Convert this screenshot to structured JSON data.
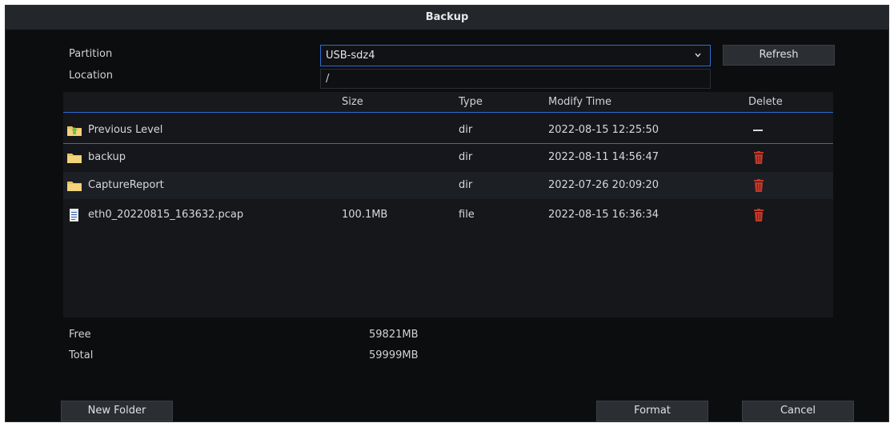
{
  "dialog": {
    "title": "Backup",
    "partition_label": "Partition",
    "location_label": "Location",
    "partition_value": "USB-sdz4",
    "location_value": "/",
    "refresh_label": "Refresh"
  },
  "table": {
    "headers": {
      "size": "Size",
      "type": "Type",
      "modify_time": "Modify Time",
      "delete": "Delete"
    },
    "rows": [
      {
        "name": "Previous Level",
        "size": "",
        "type": "dir",
        "modify_time": "2022-08-15 12:25:50",
        "icon": "folder-up-icon",
        "delete": "dash"
      },
      {
        "name": "backup",
        "size": "",
        "type": "dir",
        "modify_time": "2022-08-11 14:56:47",
        "icon": "folder-icon",
        "delete": "trash"
      },
      {
        "name": "CaptureReport",
        "size": "",
        "type": "dir",
        "modify_time": "2022-07-26 20:09:20",
        "icon": "folder-icon",
        "delete": "trash"
      },
      {
        "name": "eth0_20220815_163632.pcap",
        "size": "100.1MB",
        "type": "file",
        "modify_time": "2022-08-15 16:36:34",
        "icon": "file-icon",
        "delete": "trash"
      }
    ]
  },
  "storage": {
    "free_label": "Free",
    "free_value": "59821MB",
    "total_label": "Total",
    "total_value": "59999MB"
  },
  "buttons": {
    "new_folder": "New Folder",
    "format": "Format",
    "cancel": "Cancel"
  },
  "colors": {
    "accent": "#2f6bd6",
    "folder": "#e8c15a",
    "trash": "#c0392b"
  }
}
